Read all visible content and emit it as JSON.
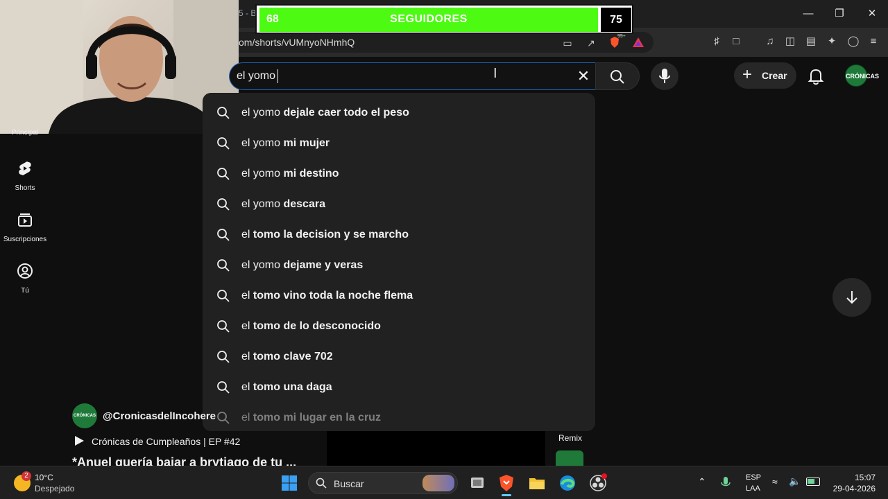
{
  "browser": {
    "tab_fragment": "5 - B",
    "url": "om/shorts/vUMnyoNHmhQ",
    "extension_badge": "99+",
    "window_controls": [
      "minimize",
      "maximize",
      "close"
    ]
  },
  "overlay": {
    "left_count": "68",
    "title": "SEGUIDORES",
    "right_count": "75",
    "accent_color": "#4cfa12"
  },
  "header": {
    "search_value": "el yomo ",
    "create_label": "Crear",
    "avatar_text": "CRÓNICAS"
  },
  "suggestions": [
    {
      "prefix": "el yomo ",
      "rest": "dejale caer todo el peso"
    },
    {
      "prefix": "el yomo ",
      "rest": "mi mujer"
    },
    {
      "prefix": "el yomo ",
      "rest": "mi destino"
    },
    {
      "prefix": "el yomo ",
      "rest": "descara"
    },
    {
      "prefix": "el ",
      "rest": "tomo la decision y se marcho"
    },
    {
      "prefix": "el yomo ",
      "rest": "dejame y veras"
    },
    {
      "prefix": "el ",
      "rest": "tomo vino toda la noche flema"
    },
    {
      "prefix": "el ",
      "rest": "tomo de lo desconocido"
    },
    {
      "prefix": "el ",
      "rest": "tomo clave 702"
    },
    {
      "prefix": "el ",
      "rest": "tomo una daga"
    },
    {
      "prefix": "el ",
      "rest": "tomo mi lugar en la cruz"
    }
  ],
  "sidebar": {
    "items": [
      {
        "label": "Principal",
        "icon": "home-icon"
      },
      {
        "label": "Shorts",
        "icon": "shorts-icon"
      },
      {
        "label": "Suscripciones",
        "icon": "subscriptions-icon"
      },
      {
        "label": "Tú",
        "icon": "user-icon"
      }
    ]
  },
  "video": {
    "channel": "@CronicasdelIncohere",
    "playlist": "Crónicas de Cumpleaños | EP #42",
    "title": "*Anuel quería bajar a brytiago de tu ...",
    "remix_label": "Remix"
  },
  "taskbar": {
    "weather_temp": "10°C",
    "weather_desc": "Despejado",
    "weather_badge": "2",
    "search_placeholder": "Buscar",
    "lang_line1": "ESP",
    "lang_line2": "LAA",
    "time": "15:07",
    "date": "29-04-2026"
  }
}
